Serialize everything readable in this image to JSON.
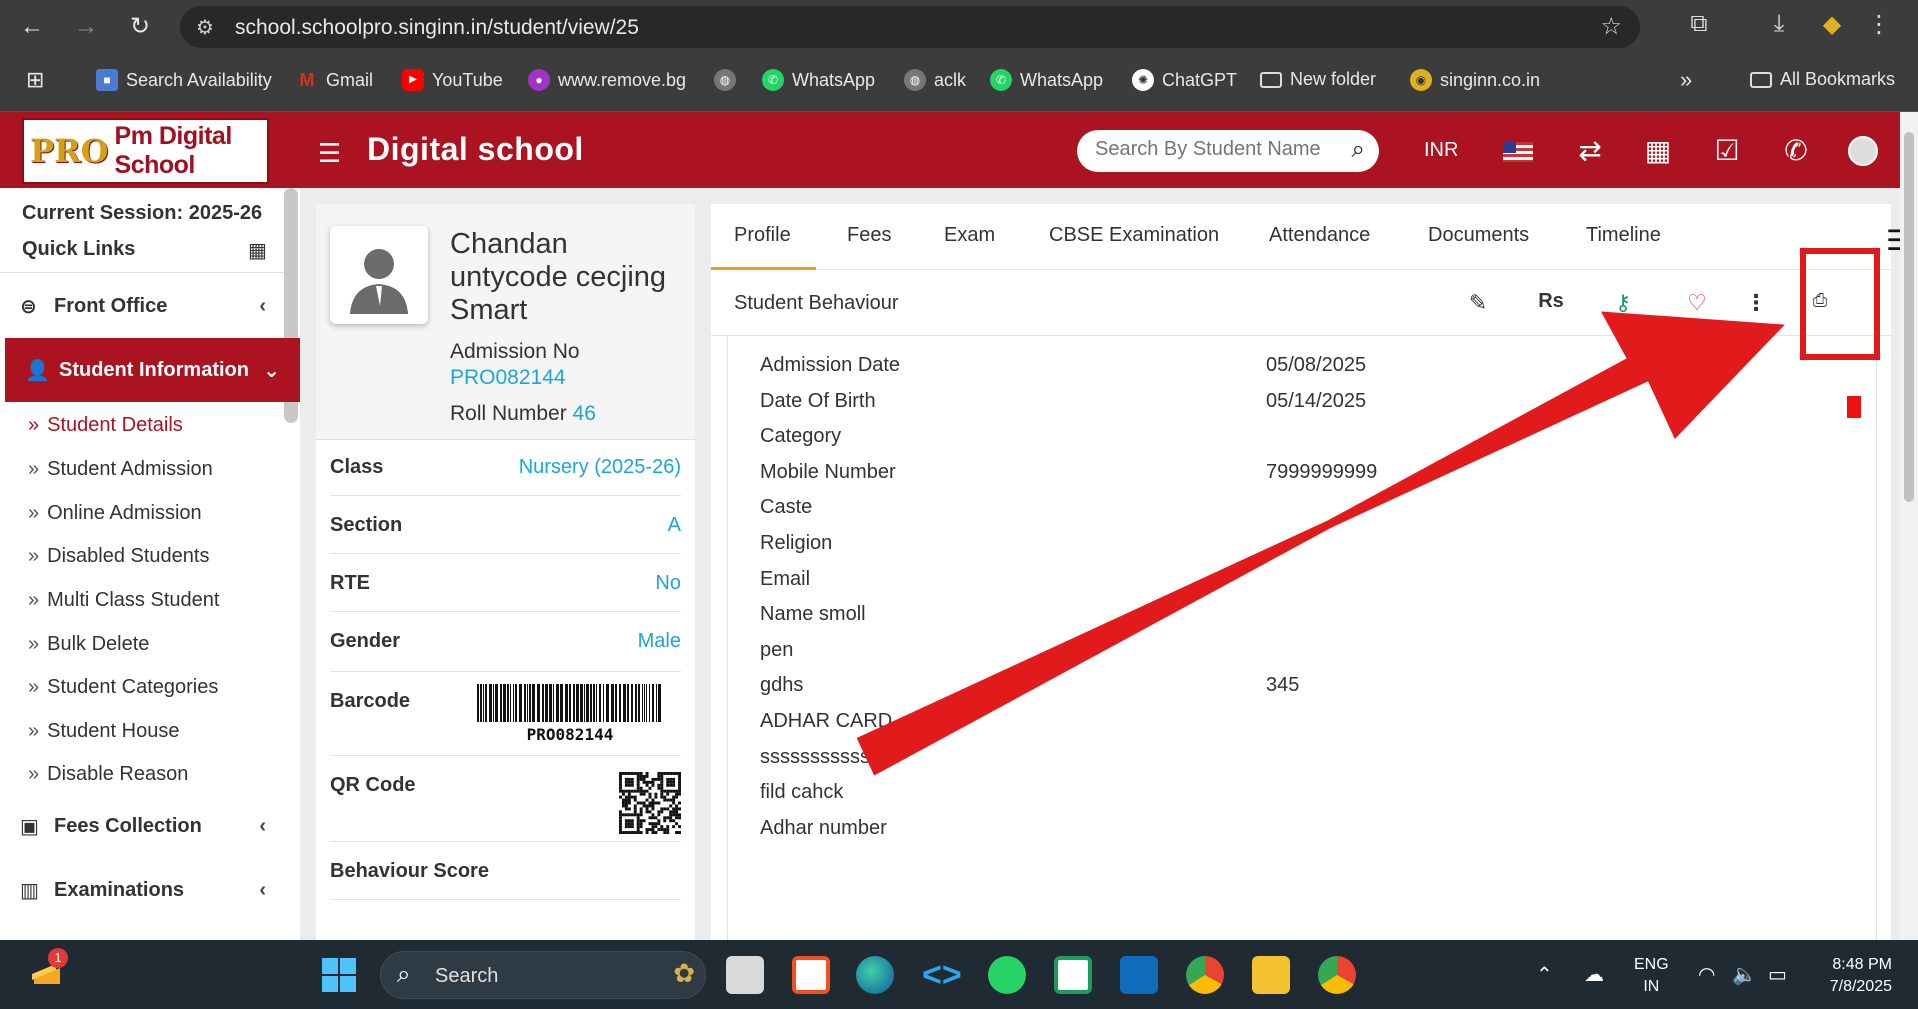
{
  "browser": {
    "url": "school.schoolpro.singinn.in/student/view/25",
    "bookmarks": [
      {
        "label": "Search Availability",
        "icon": "contact-icon",
        "color": "#4a7bd0"
      },
      {
        "label": "Gmail",
        "icon": "gmail-icon",
        "color": "#d93025"
      },
      {
        "label": "YouTube",
        "icon": "youtube-icon",
        "color": "#ff0000"
      },
      {
        "label": "www.remove.bg",
        "icon": "removebg-icon",
        "color": "#a333c8"
      },
      {
        "label": "",
        "icon": "globe-icon",
        "color": "#777777"
      },
      {
        "label": "WhatsApp",
        "icon": "whatsapp-icon",
        "color": "#25d366"
      },
      {
        "label": "aclk",
        "icon": "globe-icon",
        "color": "#777777"
      },
      {
        "label": "WhatsApp",
        "icon": "whatsapp-icon",
        "color": "#25d366"
      },
      {
        "label": "ChatGPT",
        "icon": "chatgpt-icon",
        "color": "#444444"
      },
      {
        "label": "New folder",
        "icon": "folder-icon",
        "color": "#3c3c3c"
      },
      {
        "label": "singinn.co.in",
        "icon": "singinn-icon",
        "color": "#e0b020"
      }
    ],
    "more_label": "»",
    "all_bookmarks": "All Bookmarks"
  },
  "header": {
    "logo_pro": "PRO",
    "logo_text": "Pm Digital School",
    "title": "Digital school",
    "search_placeholder": "Search By Student Name",
    "currency": "INR"
  },
  "sidebar": {
    "session": "Current Session: 2025-26",
    "quick_links": "Quick Links",
    "front_office": "Front Office",
    "student_information": "Student Information",
    "sub_items": [
      "Student Details",
      "Student Admission",
      "Online Admission",
      "Disabled Students",
      "Multi Class Student",
      "Bulk Delete",
      "Student Categories",
      "Student House",
      "Disable Reason"
    ],
    "fees_collection": "Fees Collection",
    "examinations": "Examinations"
  },
  "profile": {
    "name": "Chandan untycode cecjing Smart",
    "admission_label": "Admission No",
    "admission_no": "PRO082144",
    "roll_label": "Roll Number",
    "roll_no": "46",
    "rows": [
      {
        "label": "Class",
        "value": "Nursery (2025-26)"
      },
      {
        "label": "Section",
        "value": "A"
      },
      {
        "label": "RTE",
        "value": "No"
      },
      {
        "label": "Gender",
        "value": "Male"
      },
      {
        "label": "Barcode",
        "value": "PRO082144"
      },
      {
        "label": "QR Code",
        "value": ""
      },
      {
        "label": "Behaviour Score",
        "value": ""
      }
    ]
  },
  "tabs": [
    "Profile",
    "Fees",
    "Exam",
    "CBSE Examination",
    "Attendance",
    "Documents",
    "Timeline"
  ],
  "toolbar": {
    "behaviour_label": "Student Behaviour",
    "rs_label": "Rs"
  },
  "details": [
    {
      "label": "Admission Date",
      "value": "05/08/2025"
    },
    {
      "label": "Date Of Birth",
      "value": "05/14/2025"
    },
    {
      "label": "Category",
      "value": ""
    },
    {
      "label": "Mobile Number",
      "value": "7999999999"
    },
    {
      "label": "Caste",
      "value": ""
    },
    {
      "label": "Religion",
      "value": ""
    },
    {
      "label": "Email",
      "value": ""
    },
    {
      "label": "Name smoll",
      "value": ""
    },
    {
      "label": "pen",
      "value": ""
    },
    {
      "label": "gdhs",
      "value": "345"
    },
    {
      "label": "ADHAR CARD",
      "value": ""
    },
    {
      "label": "ssssssssssss",
      "value": ""
    },
    {
      "label": "fild cahck",
      "value": ""
    },
    {
      "label": "Adhar number",
      "value": ""
    }
  ],
  "taskbar": {
    "search": "Search",
    "badge": "1",
    "lang_line1": "ENG",
    "lang_line2": "IN",
    "time": "8:48 PM",
    "date": "7/8/2025"
  },
  "colors": {
    "brand_red": "#ac1321",
    "link_blue": "#1aa7d8",
    "annotation_red": "#e11b1b",
    "tab_accent": "#f39c12"
  }
}
